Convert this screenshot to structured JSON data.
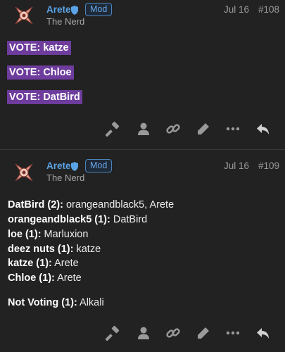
{
  "posts": [
    {
      "username": "Arete",
      "badge": "Mod",
      "user_title": "The Nerd",
      "date": "Jul 16",
      "post_number": "#108",
      "votes": [
        "VOTE: katze",
        "VOTE: Chloe",
        "VOTE: DatBird"
      ]
    },
    {
      "username": "Arete",
      "badge": "Mod",
      "user_title": "The Nerd",
      "date": "Jul 16",
      "post_number": "#109",
      "tally": [
        {
          "name": "DatBird (2):",
          "voters": " orangeandblack5, Arete"
        },
        {
          "name": "orangeandblack5 (1):",
          "voters": " DatBird"
        },
        {
          "name": "loe (1):",
          "voters": " Marluxion"
        },
        {
          "name": "deez nuts (1):",
          "voters": " katze"
        },
        {
          "name": "katze (1):",
          "voters": " Arete"
        },
        {
          "name": "Chloe (1):",
          "voters": " Arete"
        }
      ],
      "not_voting": {
        "name": "Not Voting (1):",
        "voters": " Alkali"
      }
    }
  ],
  "actions": [
    "gavel-icon",
    "user-icon",
    "link-icon",
    "pencil-icon",
    "more-icon",
    "reply-icon"
  ],
  "colors": {
    "background": "#222222",
    "username": "#5aa3e6",
    "vote_highlight": "#6d3c9c"
  }
}
